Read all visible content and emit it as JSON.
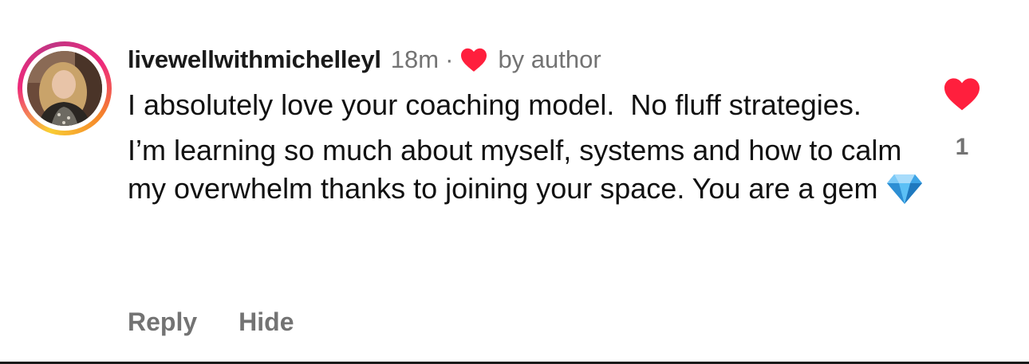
{
  "comment": {
    "username": "livewellwithmichelleyl",
    "time": "18m",
    "separator": "·",
    "liked_by_author_text": "by author",
    "paragraphs": [
      "I absolutely love your coaching model.  No fluff strategies.",
      "I’m learning so much about myself, systems and how to calm my overwhelm thanks to joining your space. You are a gem"
    ],
    "emoji": "gem-stone-emoji",
    "like_count": "1"
  },
  "actions": {
    "reply_label": "Reply",
    "hide_label": "Hide"
  },
  "icons": {
    "liked_heart": "heart-filled-icon",
    "like_button": "heart-filled-icon"
  },
  "colors": {
    "heart": "#ff1f3d",
    "secondary_text": "#737373",
    "primary_text": "#111111",
    "story_ring_start": "#f9ce34",
    "story_ring_mid": "#ee2a7b",
    "story_ring_end": "#c13584"
  }
}
